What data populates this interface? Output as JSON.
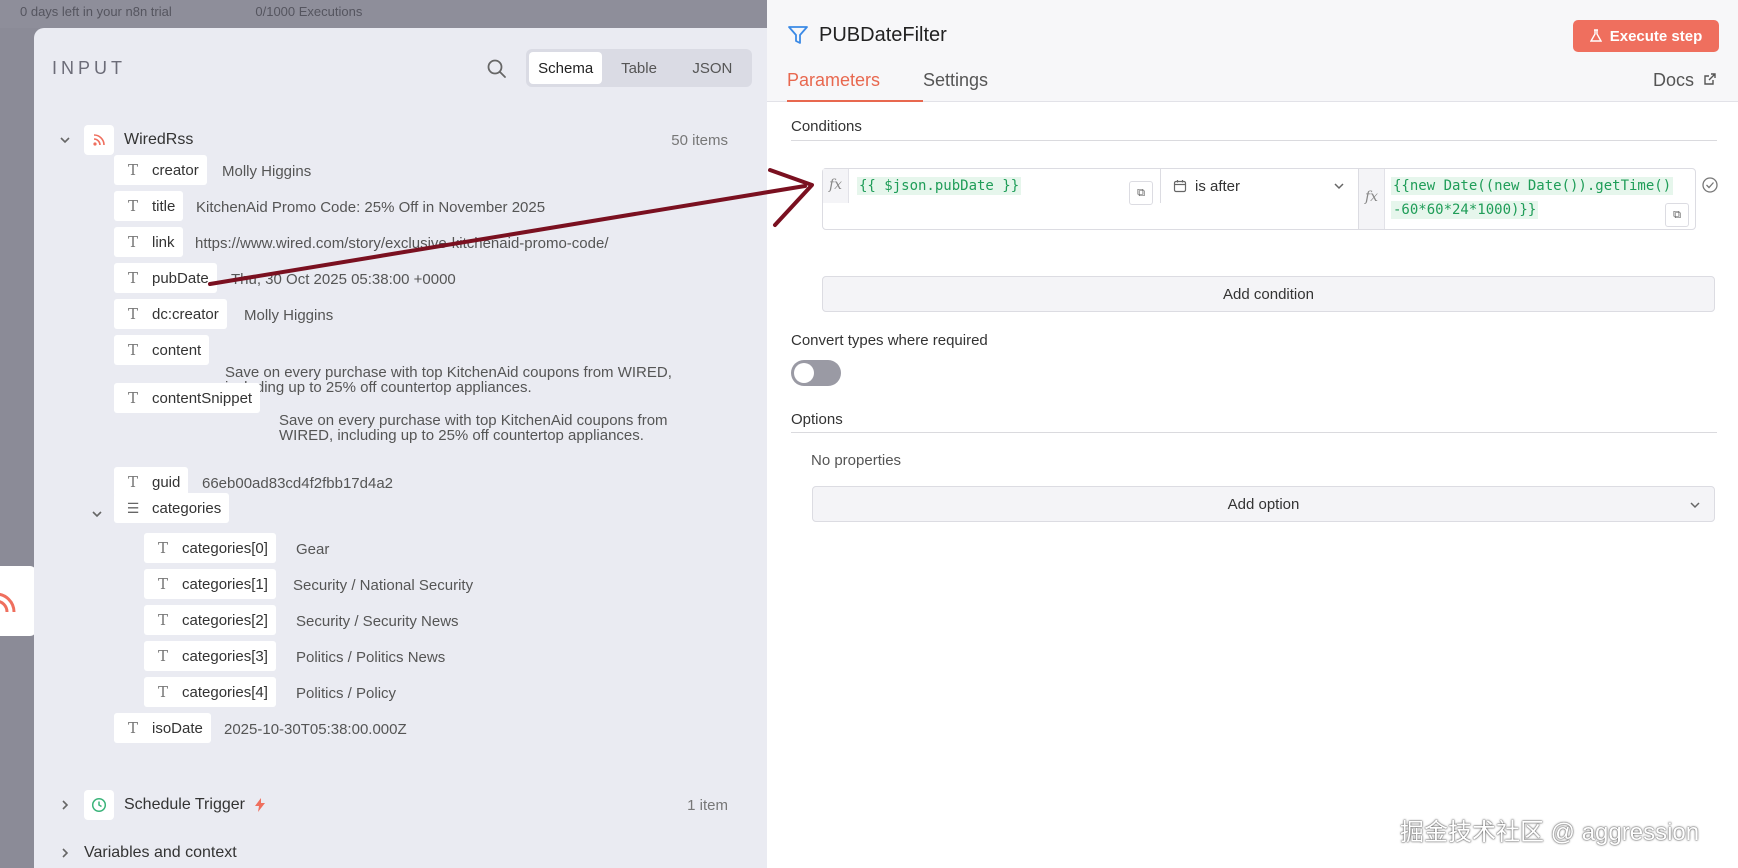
{
  "background": {
    "trial_text": "0 days left in your n8n trial",
    "executions_text": "0/1000 Executions"
  },
  "input_panel": {
    "title": "INPUT",
    "view_tabs": [
      "Schema",
      "Table",
      "JSON"
    ],
    "active_tab": "Schema",
    "nodes": [
      {
        "name": "WiredRss",
        "count": "50 items"
      },
      {
        "name": "Schedule Trigger",
        "count": "1 item"
      },
      {
        "name": "Variables and context"
      }
    ],
    "fields": [
      {
        "key": "creator",
        "value": "Molly Higgins"
      },
      {
        "key": "title",
        "value": "KitchenAid Promo Code: 25% Off in November 2025"
      },
      {
        "key": "link",
        "value": "https://www.wired.com/story/exclusive-kitchenaid-promo-code/"
      },
      {
        "key": "pubDate",
        "value": "Thu, 30 Oct 2025 05:38:00 +0000"
      },
      {
        "key": "dc:creator",
        "value": "Molly Higgins"
      },
      {
        "key": "content",
        "value": "Save on every purchase with top KitchenAid coupons from WIRED, including up to 25% off countertop appliances."
      },
      {
        "key": "contentSnippet",
        "value": "Save on every purchase with top KitchenAid coupons from WIRED, including up to 25% off countertop appliances."
      },
      {
        "key": "guid",
        "value": "66eb00ad83cd4f2fbb17d4a2"
      },
      {
        "key": "categories"
      },
      {
        "key": "isoDate",
        "value": "2025-10-30T05:38:00.000Z"
      }
    ],
    "categories": [
      {
        "key": "categories[0]",
        "value": "Gear"
      },
      {
        "key": "categories[1]",
        "value": "Security / National Security"
      },
      {
        "key": "categories[2]",
        "value": "Security / Security News"
      },
      {
        "key": "categories[3]",
        "value": "Politics / Politics News"
      },
      {
        "key": "categories[4]",
        "value": "Politics / Policy"
      }
    ]
  },
  "params_panel": {
    "node_title": "PUBDateFilter",
    "execute_label": "Execute step",
    "tabs": [
      "Parameters",
      "Settings"
    ],
    "active_tab": "Parameters",
    "docs_label": "Docs",
    "conditions_label": "Conditions",
    "condition": {
      "left_expr": "{{ $json.pubDate }}",
      "operator": "is after",
      "right_expr_line1": "{{new Date((new Date()).getTime()",
      "right_expr_line2": "-60*60*24*1000)}}"
    },
    "fx_label": "fx",
    "add_condition_label": "Add condition",
    "convert_types_label": "Convert types where required",
    "convert_types_enabled": false,
    "options_label": "Options",
    "no_properties_label": "No properties",
    "add_option_label": "Add option"
  },
  "watermark": "掘金技术社区 @ aggression",
  "colors": {
    "accent": "#e8684f",
    "execute_bg": "#ef6f5e",
    "expr_green": "#1f9d58",
    "panel_bg": "#eaebf2"
  }
}
